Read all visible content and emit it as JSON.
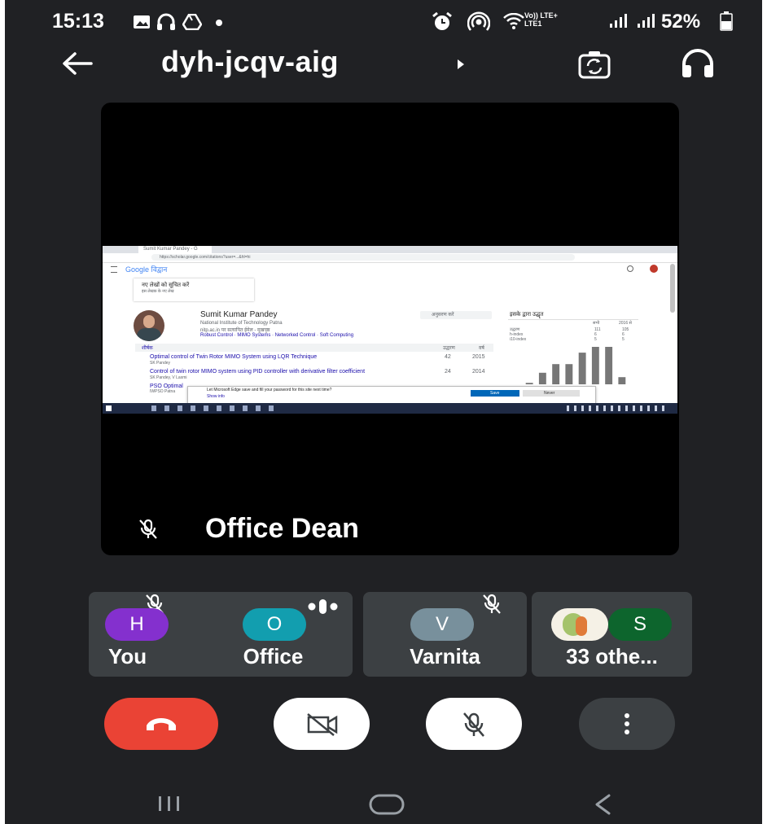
{
  "status_bar": {
    "time": "15:13",
    "network_label": "Vo)) LTE+\nLTE1",
    "battery": "52%"
  },
  "header": {
    "meeting_code": "dyh-jcqv-aig"
  },
  "presenter": {
    "name": "Office Dean",
    "muted": true,
    "shared_screen": {
      "browser_tab": "Sumit Kumar Pandey - G",
      "address": "https://scholar.google.com/citations?user=...&hl=hi",
      "scholar_logo": "Google विद्वान",
      "profile_name": "Sumit Kumar Pandey",
      "affiliation": "National Institute of Technology Patna",
      "email_line": "nitp.ac.in पर सत्यापित ईमेल - मुखपृष्ठ",
      "interests": "Robust Control · MIMO Systems · Networked Control · Soft Computing",
      "follow_button": "अनुसरण करें",
      "notice_line1": "नए लेखों को सूचित करें",
      "notice_line2": "इस लेखक के नए लेख",
      "cited_by_title": "इसके द्वारा उद्धृत",
      "cited_col_all": "सभी",
      "cited_col_since": "2016 से",
      "cited_rows": [
        {
          "label": "उद्धरण",
          "all": "111",
          "since": "105"
        },
        {
          "label": "h-index",
          "all": "6",
          "since": "6"
        },
        {
          "label": "i10-index",
          "all": "5",
          "since": "5"
        }
      ],
      "list_header_title": "शीर्षक",
      "list_header_cited": "उद्धरण",
      "list_header_year": "वर्ष",
      "papers": [
        {
          "title": "Optimal control of Twin Rotor MIMO System using LQR Technique",
          "meta": "SK Pandey",
          "cited": "42",
          "year": "2015"
        },
        {
          "title": "Control of twin rotor MIMO system using PID controller with derivative filter coefficient",
          "meta": "SK Pandey, V Laxmi",
          "cited": "24",
          "year": "2014"
        },
        {
          "title": "PSO Optimal",
          "meta": "IWPSO Patna",
          "cited": "",
          "year": ""
        }
      ],
      "edge_prompt": "Let Microsoft Edge save and fill your password for this site next time?",
      "edge_link": "Show info",
      "edge_save": "Save",
      "edge_never": "Never",
      "chart_values": [
        1,
        8,
        14,
        14,
        22,
        26,
        26,
        5
      ]
    }
  },
  "participants": [
    {
      "initial": "H",
      "label": "You",
      "avatar_color": "#8430ce",
      "muted": true
    },
    {
      "initial": "O",
      "label": "Office",
      "avatar_color": "#129eaf",
      "speaking": true
    },
    {
      "initial": "V",
      "label": "Varnita",
      "avatar_color": "#78909c",
      "muted": true
    },
    {
      "initial": "S",
      "label": "33 othe...",
      "avatar_color": "#0d652d"
    }
  ],
  "controls": {
    "end_call_color": "#ea4335"
  },
  "icons": [
    "back-arrow-icon",
    "play-arrow-icon",
    "switch-camera-icon",
    "headphones-icon",
    "mic-off-icon",
    "sound-wave-icon",
    "phone-hangup-icon",
    "camera-off-icon",
    "more-vert-icon",
    "recents-icon",
    "home-icon",
    "nav-back-icon"
  ]
}
